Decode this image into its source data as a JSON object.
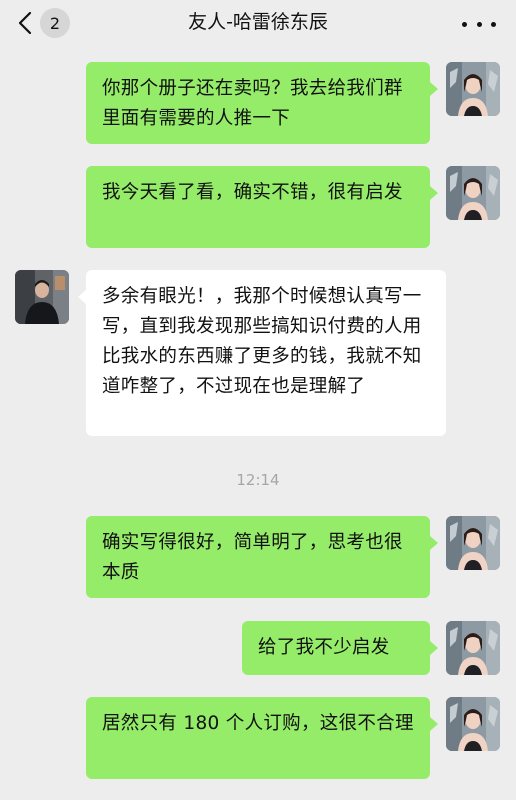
{
  "header": {
    "title": "友人-哈雷徐东辰",
    "unread_count": "2",
    "back_icon": "chevron-left-icon",
    "more_icon": "more-dots-icon"
  },
  "messages": [
    {
      "sender": "me",
      "text": "你那个册子还在卖吗？我去给我们群里面有需要的人推一下"
    },
    {
      "sender": "me",
      "text": "我今天看了看，确实不错，很有启发"
    },
    {
      "sender": "them",
      "text": "多余有眼光！，我那个时候想认真写一写，直到我发现那些搞知识付费的人用比我水的东西赚了更多的钱，我就不知道咋整了，不过现在也是理解了"
    },
    {
      "sender": "me",
      "text": "确实写得很好，简单明了，思考也很本质"
    },
    {
      "sender": "me",
      "text": "给了我不少启发"
    },
    {
      "sender": "me",
      "text": "居然只有 180 个人订购，这很不合理"
    }
  ],
  "timestamp": "12:14",
  "colors": {
    "background": "#ededed",
    "my_bubble": "#95ec69",
    "their_bubble": "#ffffff",
    "timestamp_text": "#a6a6a6"
  }
}
